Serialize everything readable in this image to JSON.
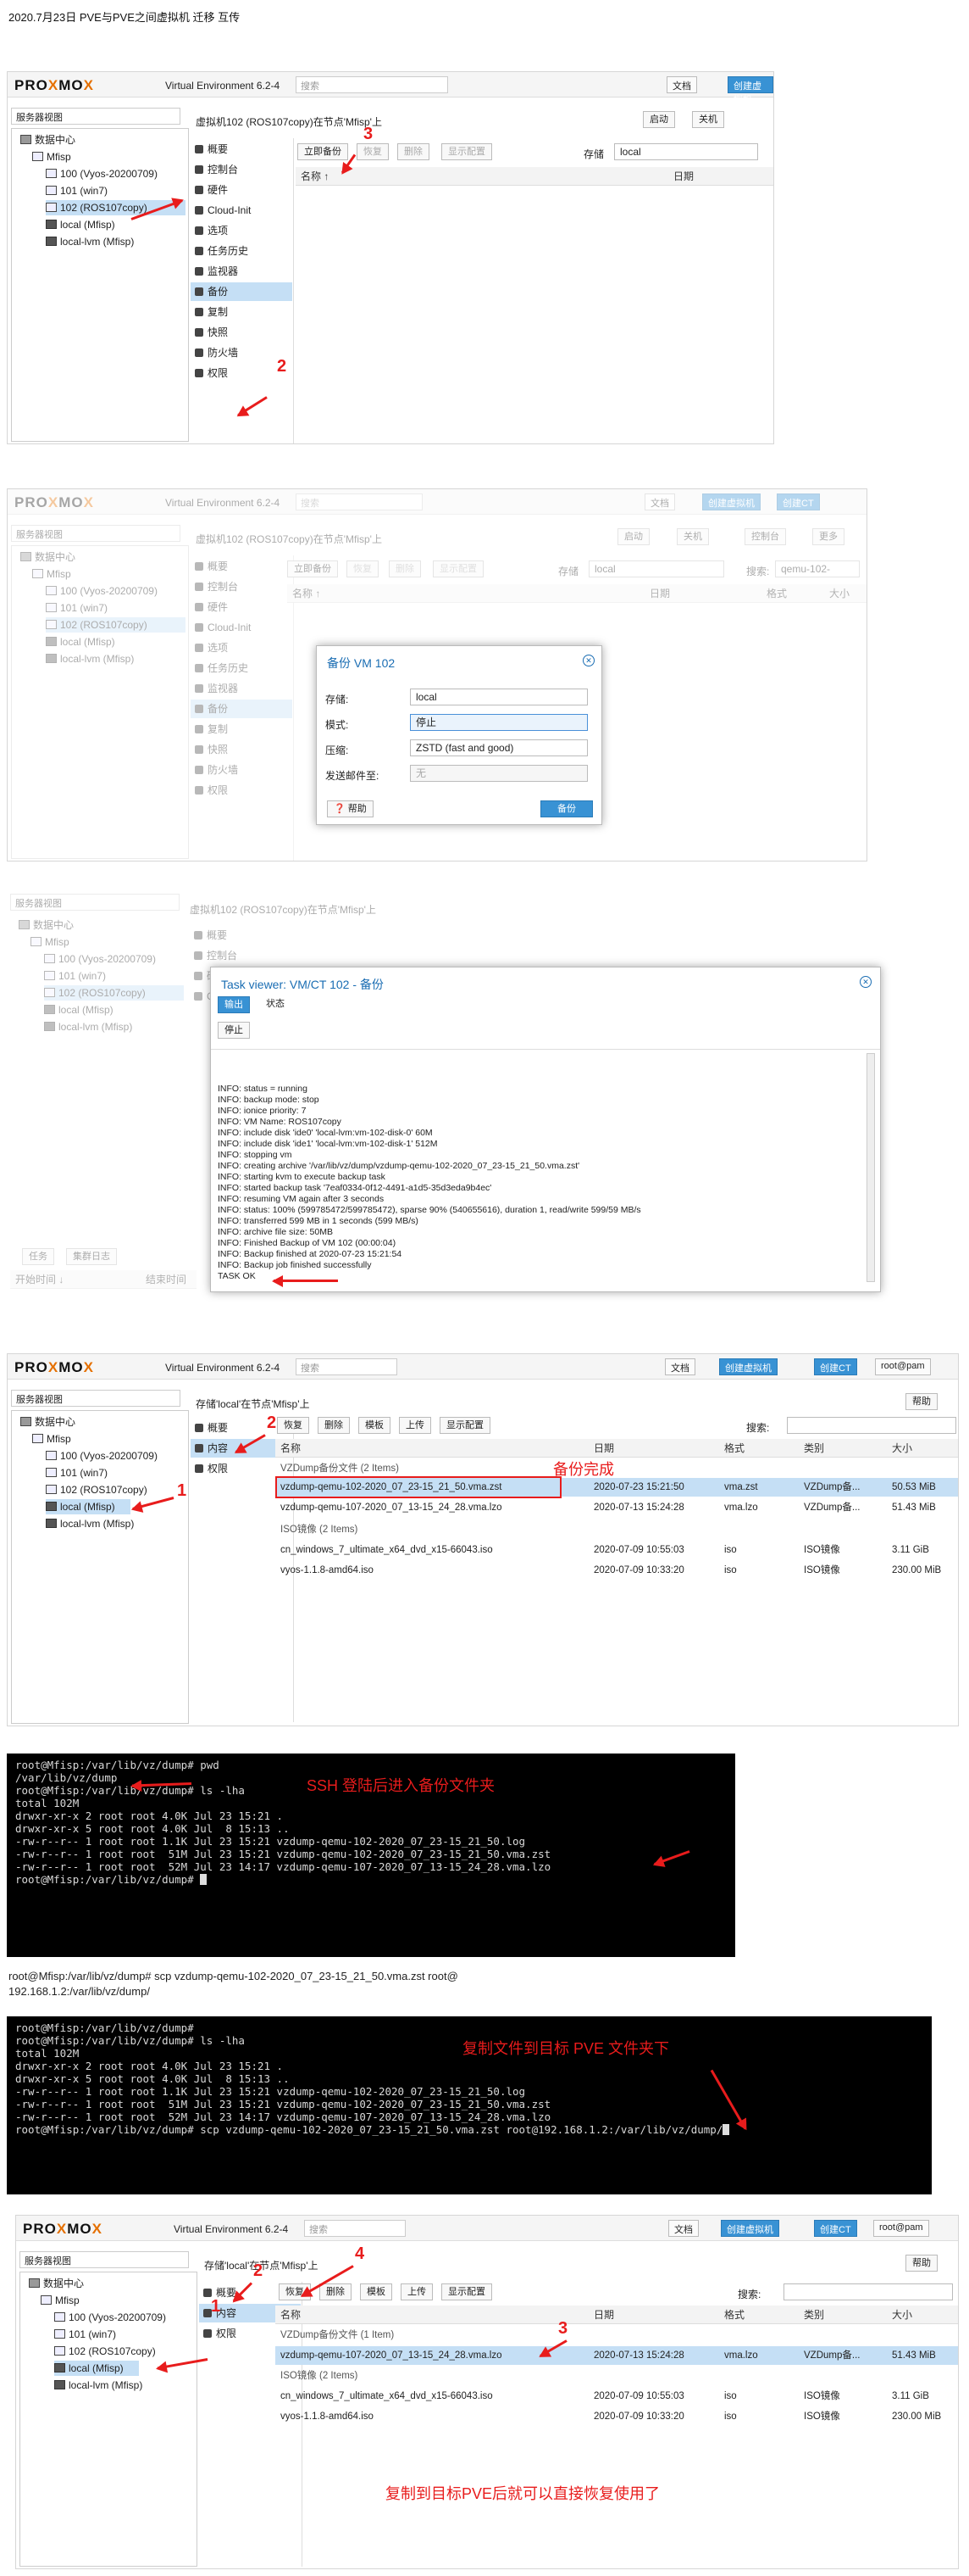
{
  "page_title": "2020.7月23日   PVE与PVE之间虚拟机 迁移 互传",
  "pve": {
    "logo_left": "PRO",
    "logo_x": "X",
    "logo_mid": "MO",
    "logo_x2": "X",
    "version": "Virtual Environment 6.2-4",
    "search_placeholder": "搜索",
    "docs": "文档",
    "create_vm": "创建虚拟机",
    "create_ct": "创建CT",
    "user": "root@pam",
    "view": "服务器视图",
    "datacenter": "数据中心",
    "node": "Mfisp",
    "vm100": "100 (Vyos-20200709)",
    "vm101": "101 (win7)",
    "vm102": "102 (ROS107copy)",
    "local": "local (Mfisp)",
    "local_lvm": "local-lvm (Mfisp)"
  },
  "sec1": {
    "crumb": "虚拟机102 (ROS107copy)在节点'Mfisp'上",
    "start": "启动",
    "shutdown": "关机",
    "menu": [
      "概要",
      "控制台",
      "硬件",
      "Cloud-Init",
      "选项",
      "任务历史",
      "监视器",
      "备份",
      "复制",
      "快照",
      "防火墙",
      "权限"
    ],
    "backup_now": "立即备份",
    "restore": "恢复",
    "delete": "删除",
    "show_config": "显示配置",
    "storage_label": "存储",
    "storage_value": "local",
    "col_name": "名称 ↑",
    "col_date": "日期",
    "num2": "2",
    "num3": "3"
  },
  "sec2": {
    "more": "更多",
    "console": "控制台",
    "search_label": "搜索:",
    "search_value": "qemu-102-",
    "col_format": "格式",
    "col_size": "大小",
    "dialog_title": "备份 VM 102",
    "f_storage": "存储:",
    "f_storage_v": "local",
    "f_mode": "模式:",
    "f_mode_v": "停止",
    "f_comp": "压缩:",
    "f_comp_v": "ZSTD (fast and good)",
    "f_mail": "发送邮件至:",
    "f_mail_v": "无",
    "help": "帮助",
    "backup": "备份"
  },
  "sec3": {
    "task_title": "Task viewer: VM/CT 102 - 备份",
    "tab_output": "输出",
    "tab_status": "状态",
    "stop": "停止",
    "tasks": "任务",
    "cluster_log": "集群日志",
    "start_time": "开始时间 ↓",
    "end_time": "结束时间",
    "log": [
      "INFO: status = running",
      "INFO: backup mode: stop",
      "INFO: ionice priority: 7",
      "INFO: VM Name: ROS107copy",
      "INFO: include disk 'ide0' 'local-lvm:vm-102-disk-0' 60M",
      "INFO: include disk 'ide1' 'local-lvm:vm-102-disk-1' 512M",
      "INFO: stopping vm",
      "INFO: creating archive '/var/lib/vz/dump/vzdump-qemu-102-2020_07_23-15_21_50.vma.zst'",
      "INFO: starting kvm to execute backup task",
      "INFO: started backup task '7eaf0334-0f12-4491-a1d5-35d3eda9b4ec'",
      "INFO: resuming VM again after 3 seconds",
      "INFO: status: 100% (599785472/599785472), sparse 90% (540655616), duration 1, read/write 599/59 MB/s",
      "INFO: transferred 599 MB in 1 seconds (599 MB/s)",
      "INFO: archive file size: 50MB",
      "INFO: Finished Backup of VM 102 (00:00:04)",
      "INFO: Backup finished at 2020-07-23 15:21:54",
      "INFO: Backup job finished successfully",
      "TASK OK"
    ]
  },
  "sec4": {
    "crumb": "存储'local'在节点'Mfisp'上",
    "help": "帮助",
    "menu": [
      "概要",
      "内容",
      "权限"
    ],
    "upload": "上传",
    "template": "模板",
    "restore": "恢复",
    "delete": "删除",
    "show_config": "显示配置",
    "search_label": "搜索:",
    "col_name": "名称",
    "col_date": "日期",
    "col_format": "格式",
    "col_type": "类别",
    "col_size": "大小",
    "group_vzdump": "VZDump备份文件 (2 Items)",
    "group_iso": "ISO镜像 (2 Items)",
    "rows": [
      {
        "name": "vzdump-qemu-102-2020_07_23-15_21_50.vma.zst",
        "date": "2020-07-23 15:21:50",
        "fmt": "vma.zst",
        "type": "VZDump备...",
        "size": "50.53 MiB"
      },
      {
        "name": "vzdump-qemu-107-2020_07_13-15_24_28.vma.lzo",
        "date": "2020-07-13 15:24:28",
        "fmt": "vma.lzo",
        "type": "VZDump备...",
        "size": "51.43 MiB"
      }
    ],
    "iso_rows": [
      {
        "name": "cn_windows_7_ultimate_x64_dvd_x15-66043.iso",
        "date": "2020-07-09 10:55:03",
        "fmt": "iso",
        "type": "ISO镜像",
        "size": "3.11 GiB"
      },
      {
        "name": "vyos-1.1.8-amd64.iso",
        "date": "2020-07-09 10:33:20",
        "fmt": "iso",
        "type": "ISO镜像",
        "size": "230.00 MiB"
      }
    ],
    "note": "备份完成",
    "num1": "1",
    "num2": "2"
  },
  "term1": {
    "lines": [
      "root@Mfisp:/var/lib/vz/dump# pwd",
      "/var/lib/vz/dump",
      "root@Mfisp:/var/lib/vz/dump# ls -lha",
      "total 102M",
      "drwxr-xr-x 2 root root 4.0K Jul 23 15:21 .",
      "drwxr-xr-x 5 root root 4.0K Jul  8 15:13 ..",
      "-rw-r--r-- 1 root root 1.1K Jul 23 15:21 vzdump-qemu-102-2020_07_23-15_21_50.log",
      "-rw-r--r-- 1 root root  51M Jul 23 15:21 vzdump-qemu-102-2020_07_23-15_21_50.vma.zst",
      "-rw-r--r-- 1 root root  52M Jul 23 14:17 vzdump-qemu-107-2020_07_13-15_24_28.vma.lzo",
      "root@Mfisp:/var/lib/vz/dump# "
    ],
    "note": "SSH 登陆后进入备份文件夹"
  },
  "cmd_text_1": "root@Mfisp:/var/lib/vz/dump# scp vzdump-qemu-102-2020_07_23-15_21_50.vma.zst root@",
  "cmd_text_2": "192.168.1.2:/var/lib/vz/dump/",
  "term2": {
    "lines": [
      "root@Mfisp:/var/lib/vz/dump# ",
      "root@Mfisp:/var/lib/vz/dump# ls -lha",
      "total 102M",
      "drwxr-xr-x 2 root root 4.0K Jul 23 15:21 .",
      "drwxr-xr-x 5 root root 4.0K Jul  8 15:13 ..",
      "-rw-r--r-- 1 root root 1.1K Jul 23 15:21 vzdump-qemu-102-2020_07_23-15_21_50.log",
      "-rw-r--r-- 1 root root  51M Jul 23 15:21 vzdump-qemu-102-2020_07_23-15_21_50.vma.zst",
      "-rw-r--r-- 1 root root  52M Jul 23 14:17 vzdump-qemu-107-2020_07_13-15_24_28.vma.lzo",
      "root@Mfisp:/var/lib/vz/dump# scp vzdump-qemu-102-2020_07_23-15_21_50.vma.zst root@192.168.1.2:/var/lib/vz/dump/"
    ],
    "note": "复制文件到目标 PVE 文件夹下"
  },
  "sec5": {
    "group_vzdump": "VZDump备份文件 (1 Item)",
    "group_iso": "ISO镜像 (2 Items)",
    "row": {
      "name": "vzdump-qemu-107-2020_07_13-15_24_28.vma.lzo",
      "date": "2020-07-13 15:24:28",
      "fmt": "vma.lzo",
      "type": "VZDump备...",
      "size": "51.43 MiB"
    },
    "note": "复制到目标PVE后就可以直接恢复使用了",
    "num1": "1",
    "num2": "2",
    "num3": "3",
    "num4": "4"
  }
}
